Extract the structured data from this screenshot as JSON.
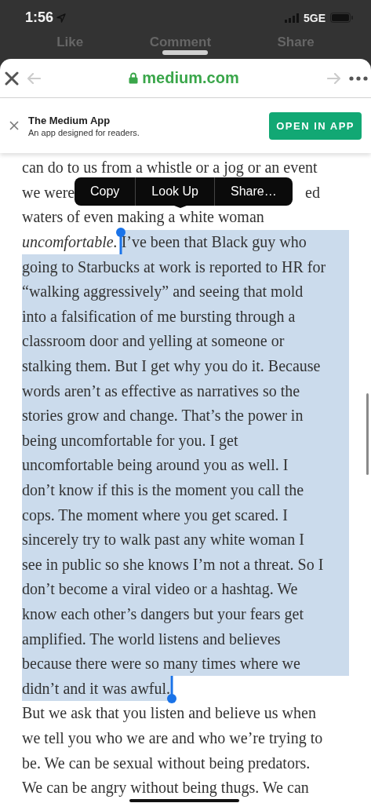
{
  "status_bar": {
    "time": "1:56",
    "network": "5GE"
  },
  "background_actions": [
    "Like",
    "Comment",
    "Share"
  ],
  "browser": {
    "url": "medium.com"
  },
  "app_banner": {
    "title": "The Medium App",
    "subtitle": "An app designed for readers.",
    "button": "OPEN IN APP"
  },
  "context_menu": [
    "Copy",
    "Look Up",
    "Share…"
  ],
  "article_lines": [
    {
      "segments": [
        {
          "text": "can do to us from a whistle or a jog or an event",
          "selected": false
        }
      ]
    },
    {
      "segments": [
        {
          "text": "we were",
          "selected": false
        },
        {
          "text": "ed",
          "selected": false
        }
      ]
    },
    {
      "segments": [
        {
          "text": "waters of even making a white woman",
          "selected": false
        }
      ]
    },
    {
      "segments": [
        {
          "text": "*uncomfortable.*",
          "selected": false
        },
        {
          "text": "I’ve been that Black guy who",
          "selected": true
        }
      ]
    },
    {
      "segments": [
        {
          "text": "going to Starbucks at work is reported to HR for",
          "selected": true
        }
      ]
    },
    {
      "segments": [
        {
          "text": "“walking aggressively” and seeing that mold",
          "selected": true
        }
      ]
    },
    {
      "segments": [
        {
          "text": "into a falsification of me bursting through a",
          "selected": true
        }
      ]
    },
    {
      "segments": [
        {
          "text": "classroom door and yelling at someone or",
          "selected": true
        }
      ]
    },
    {
      "segments": [
        {
          "text": "stalking them. But I get why you do it. Because",
          "selected": true
        }
      ]
    },
    {
      "segments": [
        {
          "text": "words aren’t as effective as narratives so the",
          "selected": true
        }
      ]
    },
    {
      "segments": [
        {
          "text": "stories grow and change. That’s the power in",
          "selected": true
        }
      ]
    },
    {
      "segments": [
        {
          "text": "being uncomfortable for you. I get",
          "selected": true
        }
      ]
    },
    {
      "segments": [
        {
          "text": "uncomfortable being around you as well. I",
          "selected": true
        }
      ]
    },
    {
      "segments": [
        {
          "text": "don’t know if this is the moment you call the",
          "selected": true
        }
      ]
    },
    {
      "segments": [
        {
          "text": "cops. The moment where you get scared. I",
          "selected": true
        }
      ]
    },
    {
      "segments": [
        {
          "text": "sincerely try to walk past any white woman I",
          "selected": true
        }
      ]
    },
    {
      "segments": [
        {
          "text": "see in public so she knows I’m not a threat. So I",
          "selected": true
        }
      ]
    },
    {
      "segments": [
        {
          "text": "don’t become a viral video or a hashtag. We",
          "selected": true
        }
      ]
    },
    {
      "segments": [
        {
          "text": "know each other’s dangers but your fears get",
          "selected": true
        }
      ]
    },
    {
      "segments": [
        {
          "text": "amplified. The world listens and believes",
          "selected": true
        }
      ]
    },
    {
      "segments": [
        {
          "text": "because there were so many times where we",
          "selected": true
        }
      ]
    },
    {
      "segments": [
        {
          "text": "didn’t and it was awful.",
          "selected": true
        }
      ]
    },
    {
      "segments": [
        {
          "text": "But we ask that you listen and believe us when",
          "selected": false
        }
      ]
    },
    {
      "segments": [
        {
          "text": "we tell you who we are and who we’re trying to",
          "selected": false
        }
      ]
    },
    {
      "segments": [
        {
          "text": "be. We can be sexual without being predators.",
          "selected": false
        }
      ]
    },
    {
      "segments": [
        {
          "text": "We can be angry without being thugs. We can",
          "selected": false
        }
      ]
    }
  ]
}
